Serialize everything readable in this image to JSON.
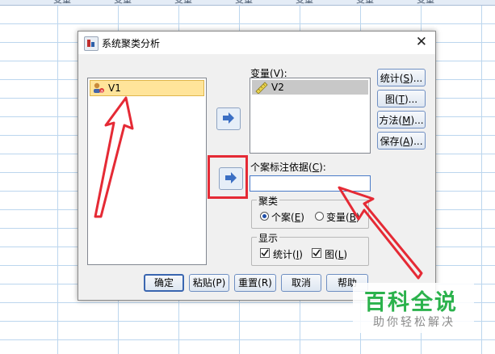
{
  "sheet": {
    "header_label": "变量"
  },
  "dialog": {
    "title": "系统聚类分析",
    "source_list": [
      {
        "label": "V1"
      }
    ],
    "variables": {
      "label_text": "变量(",
      "label_key": "V",
      "label_end": "):",
      "items": [
        {
          "label": "V2"
        }
      ]
    },
    "case_label": {
      "label_text": "个案标注依据(",
      "label_key": "C",
      "label_end": "):",
      "value": ""
    },
    "side_buttons": [
      {
        "text": "统计(",
        "key": "S",
        "end": ")..."
      },
      {
        "text": "图(",
        "key": "T",
        "end": ")..."
      },
      {
        "text": "方法(",
        "key": "M",
        "end": ")..."
      },
      {
        "text": "保存(",
        "key": "A",
        "end": ")..."
      }
    ],
    "cluster_group": {
      "title": "聚类",
      "options": [
        {
          "text": "个案(",
          "key": "E",
          "end": ")",
          "selected": true
        },
        {
          "text": "变量(",
          "key": "B",
          "end": ")",
          "selected": false
        }
      ]
    },
    "display_group": {
      "title": "显示",
      "options": [
        {
          "text": "统计(",
          "key": "I",
          "end": ")",
          "checked": true
        },
        {
          "text": "图(",
          "key": "L",
          "end": ")",
          "checked": true
        }
      ]
    },
    "bottom_buttons": [
      {
        "label": "确定"
      },
      {
        "label": "粘贴(P)"
      },
      {
        "label": "重置(R)"
      },
      {
        "label": "取消"
      },
      {
        "label": "帮助"
      }
    ]
  },
  "watermark": {
    "title": "百科全说",
    "subtitle": "助你轻松解决"
  },
  "colors": {
    "annotation_red": "#e52a35",
    "selection": "#ffe49a",
    "watermark_green": "#2bb24c"
  }
}
